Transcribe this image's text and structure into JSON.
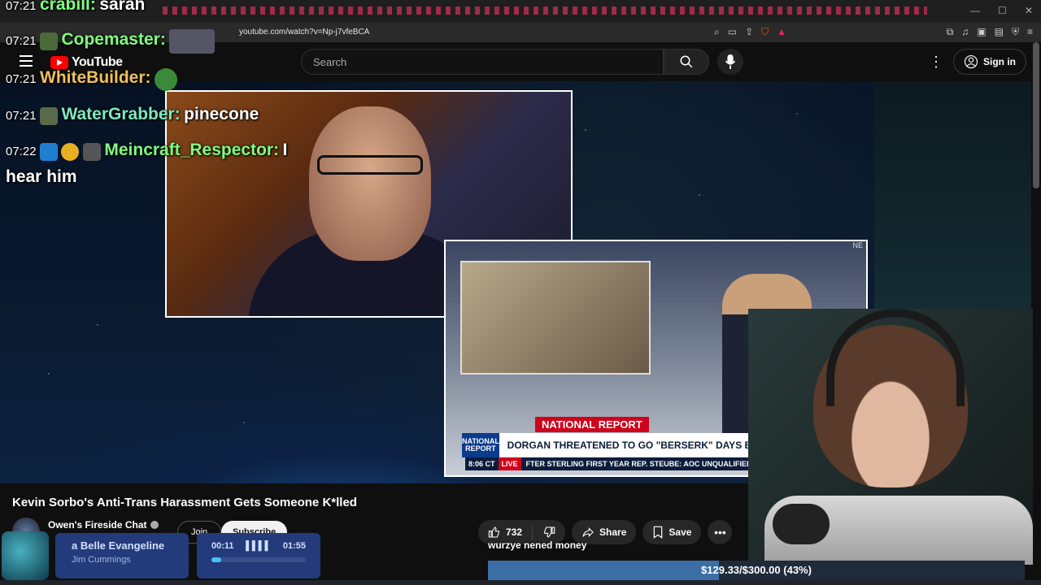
{
  "browser": {
    "url": "youtube.com/watch?v=Np-j7vfeBCA"
  },
  "youtube": {
    "logo_text": "YouTube",
    "search_placeholder": "Search",
    "signin_label": "Sign in"
  },
  "chat": [
    {
      "time": "07:21",
      "name": "crabill",
      "message": "sarah",
      "color": "#7fff7f"
    },
    {
      "time": "07:21",
      "name": "Copemaster",
      "message": "",
      "color": "#7fff7f"
    },
    {
      "time": "07:21",
      "name": "WhiteBuilder",
      "message": "",
      "color": "#f0c060"
    },
    {
      "time": "07:21",
      "name": "WaterGrabber",
      "message": "pinecone",
      "color": "#7fe8c0"
    },
    {
      "time": "07:22",
      "name": "Meincraft_Respector",
      "message": "I",
      "color": "#7fff7f"
    },
    {
      "continuation": "hear him"
    }
  ],
  "news": {
    "banner": "NATIONAL REPORT",
    "logo": "NATIONAL REPORT",
    "headline": "DORGAN THREATENED TO GO \"BERSERK\" DAYS BEFORE SHOOTING",
    "time": "8:06 CT",
    "live": "LIVE",
    "ticker": "FTER STERLING FIRST YEAR     REP. STEUBE: AOC UNQUALIFIED FOR MUNICH SEC"
  },
  "video": {
    "title": "Kevin Sorbo's Anti-Trans Harassment Gets Someone K*lled",
    "channel": "Owen's Fireside Chat",
    "join_label": "Join",
    "subscribe_label": "Subscribe",
    "likes": "732",
    "share_label": "Share",
    "save_label": "Save"
  },
  "donation": {
    "message": "wurzye nened money",
    "goal_text": "$129.33/$300.00 (43%)",
    "progress": 0.43
  },
  "music": {
    "song": "a Belle Evangeline",
    "artist": "Jim Cummings",
    "elapsed": "00:11",
    "duration": "01:55",
    "progress": 0.1
  },
  "colors": {
    "accent": "#ff0000",
    "bg": "#0f0f0f"
  }
}
